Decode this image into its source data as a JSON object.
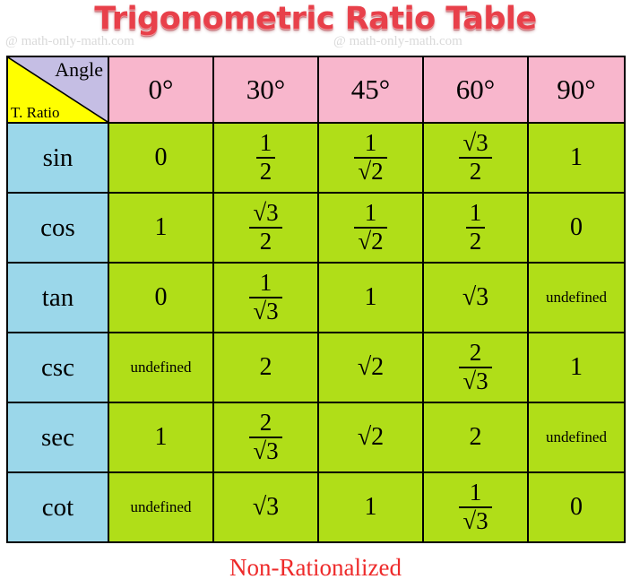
{
  "title": "Trigonometric Ratio Table",
  "caption": "Non-Rationalized",
  "watermark": {
    "text": "@ math-only-math.com"
  },
  "colors": {
    "title": "#e8404a",
    "header_pink": "#f8b6cc",
    "corner_purple": "#c5bee4",
    "corner_yellow": "#ffff00",
    "row_label_blue": "#9bd7ea",
    "value_green": "#b0de18",
    "caption_red": "#ee2a2a",
    "border": "#000000"
  },
  "table": {
    "corner": {
      "angle_label": "Angle",
      "ratio_label": "T. Ratio"
    },
    "angles": [
      "0°",
      "30°",
      "45°",
      "60°",
      "90°"
    ],
    "rows": [
      {
        "ratio": "sin",
        "values": [
          {
            "type": "plain",
            "text": "0"
          },
          {
            "type": "fraction",
            "num": "1",
            "den": "2"
          },
          {
            "type": "fraction",
            "num": "1",
            "den": "√2"
          },
          {
            "type": "fraction",
            "num": "√3",
            "den": "2"
          },
          {
            "type": "plain",
            "text": "1"
          }
        ]
      },
      {
        "ratio": "cos",
        "values": [
          {
            "type": "plain",
            "text": "1"
          },
          {
            "type": "fraction",
            "num": "√3",
            "den": "2"
          },
          {
            "type": "fraction",
            "num": "1",
            "den": "√2"
          },
          {
            "type": "fraction",
            "num": "1",
            "den": "2"
          },
          {
            "type": "plain",
            "text": "0"
          }
        ]
      },
      {
        "ratio": "tan",
        "values": [
          {
            "type": "plain",
            "text": "0"
          },
          {
            "type": "fraction",
            "num": "1",
            "den": "√3"
          },
          {
            "type": "plain",
            "text": "1"
          },
          {
            "type": "plain",
            "text": "√3"
          },
          {
            "type": "plain-small",
            "text": "undefined"
          }
        ]
      },
      {
        "ratio": "csc",
        "values": [
          {
            "type": "plain-small",
            "text": "undefined"
          },
          {
            "type": "plain",
            "text": "2"
          },
          {
            "type": "plain",
            "text": "√2"
          },
          {
            "type": "fraction",
            "num": "2",
            "den": "√3"
          },
          {
            "type": "plain",
            "text": "1"
          }
        ]
      },
      {
        "ratio": "sec",
        "values": [
          {
            "type": "plain",
            "text": "1"
          },
          {
            "type": "fraction",
            "num": "2",
            "den": "√3"
          },
          {
            "type": "plain",
            "text": "√2"
          },
          {
            "type": "plain",
            "text": "2"
          },
          {
            "type": "plain-small",
            "text": "undefined"
          }
        ]
      },
      {
        "ratio": "cot",
        "values": [
          {
            "type": "plain-small",
            "text": "undefined"
          },
          {
            "type": "plain",
            "text": "√3"
          },
          {
            "type": "plain",
            "text": "1"
          },
          {
            "type": "fraction",
            "num": "1",
            "den": "√3"
          },
          {
            "type": "plain",
            "text": "0"
          }
        ]
      }
    ]
  }
}
